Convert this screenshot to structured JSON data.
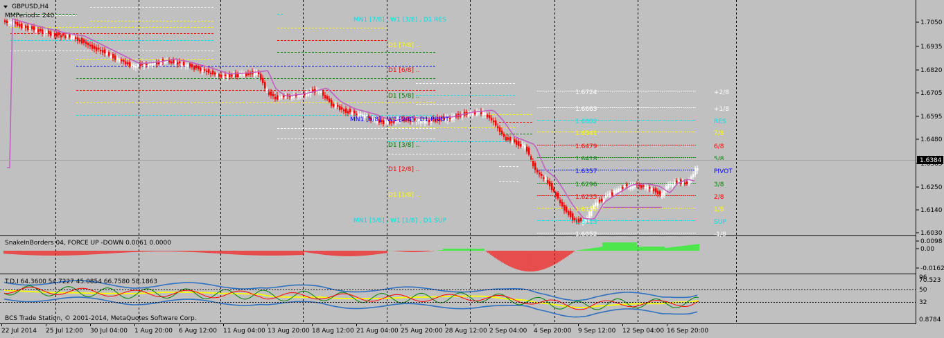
{
  "window_title": "GBPUSD,H4",
  "indicator_label": "MMPeriod= 240",
  "colors": {
    "background": "#c0c0c0",
    "separator": "#000000",
    "grid": "#000000",
    "bear_candle": "#ff0000",
    "bull_candle": "#ffffff",
    "ma_line": "#c060c0",
    "snake_up": "#00ff00",
    "snake_down": "#ff0000",
    "tdi_yellow": "#ffff00",
    "tdi_blue": "#3070c0",
    "tdi_green": "#008000",
    "tdi_red": "#ff0000",
    "current_price_box": "#000000"
  },
  "current_price": "1.6384",
  "price_axis_labels": [
    "1.7050",
    "1.6935",
    "1.6820",
    "1.6705",
    "1.6595",
    "1.6480",
    "1.6365",
    "1.6250",
    "1.6140",
    "1.6030"
  ],
  "murrey_levels": [
    {
      "price": "1.6724",
      "label": "+2/8",
      "color": "#ffffff"
    },
    {
      "price": "1.6663",
      "label": "+1/8",
      "color": "#ffffff"
    },
    {
      "price": "1.6602",
      "label": "RES",
      "color": "#00e0e0"
    },
    {
      "price": "1.6541",
      "label": "7/8",
      "color": "#ffff00"
    },
    {
      "price": "1.6479",
      "label": "6/8",
      "color": "#ff0000"
    },
    {
      "price": "1.6418",
      "label": "5/8",
      "color": "#008000"
    },
    {
      "price": "1.6357",
      "label": "PIVOT",
      "color": "#0000ff"
    },
    {
      "price": "1.6296",
      "label": "3/8",
      "color": "#008000"
    },
    {
      "price": "1.6235",
      "label": "2/8",
      "color": "#ff0000"
    },
    {
      "price": "1.6174",
      "label": "1/8",
      "color": "#ffff00"
    },
    {
      "price": "1.6113",
      "label": "SUP",
      "color": "#00e0e0"
    },
    {
      "price": "1.6052",
      "label": "-1/8",
      "color": "#ffffff"
    }
  ],
  "text_labels": {
    "mn1_res": "MN1 [7/8] , W1 [3/8] , D1 RES",
    "d1_78": "D1 [7/8] ..",
    "d1_68": "D1 [6/8] ..",
    "d1_58": "D1 [5/8] ..",
    "pivot_row": "MN1 [6/8] , W1 [2/8] , D1 PIVOT",
    "d1_38": "D1 [3/8] ..",
    "d1_28": "D1 [2/8] ..",
    "d1_18": "D1 [1/8] ..",
    "mn1_sup": "MN1 [5/8] , W1 [1/8] , D1 SUP"
  },
  "snake_panel": {
    "title": "SnakeInBorders 04, FORCE UP -DOWN  0.0061 0.0000",
    "axis_labels": [
      "0.0098",
      "0.00",
      "-0.0162"
    ]
  },
  "tdi_panel": {
    "title": "T.D.I 64.3600 54.7227 45.0854 66.7580 58.1863",
    "axis_labels": [
      "96",
      "70.523",
      "50",
      "32",
      "0.8784"
    ]
  },
  "copyright": "BCS Trade Station, © 2001-2014, MetaQuotes Software Corp.",
  "time_axis_labels": [
    "22 Jul 2014",
    "25 Jul 12:00",
    "30 Jul 04:00",
    "1 Aug 20:00",
    "6 Aug 12:00",
    "11 Aug 04:00",
    "13 Aug 20:00",
    "18 Aug 12:00",
    "21 Aug 04:00",
    "25 Aug 20:00",
    "28 Aug 12:00",
    "2 Sep 04:00",
    "4 Sep 20:00",
    "9 Sep 12:00",
    "12 Sep 04:00",
    "16 Sep 20:00"
  ]
}
